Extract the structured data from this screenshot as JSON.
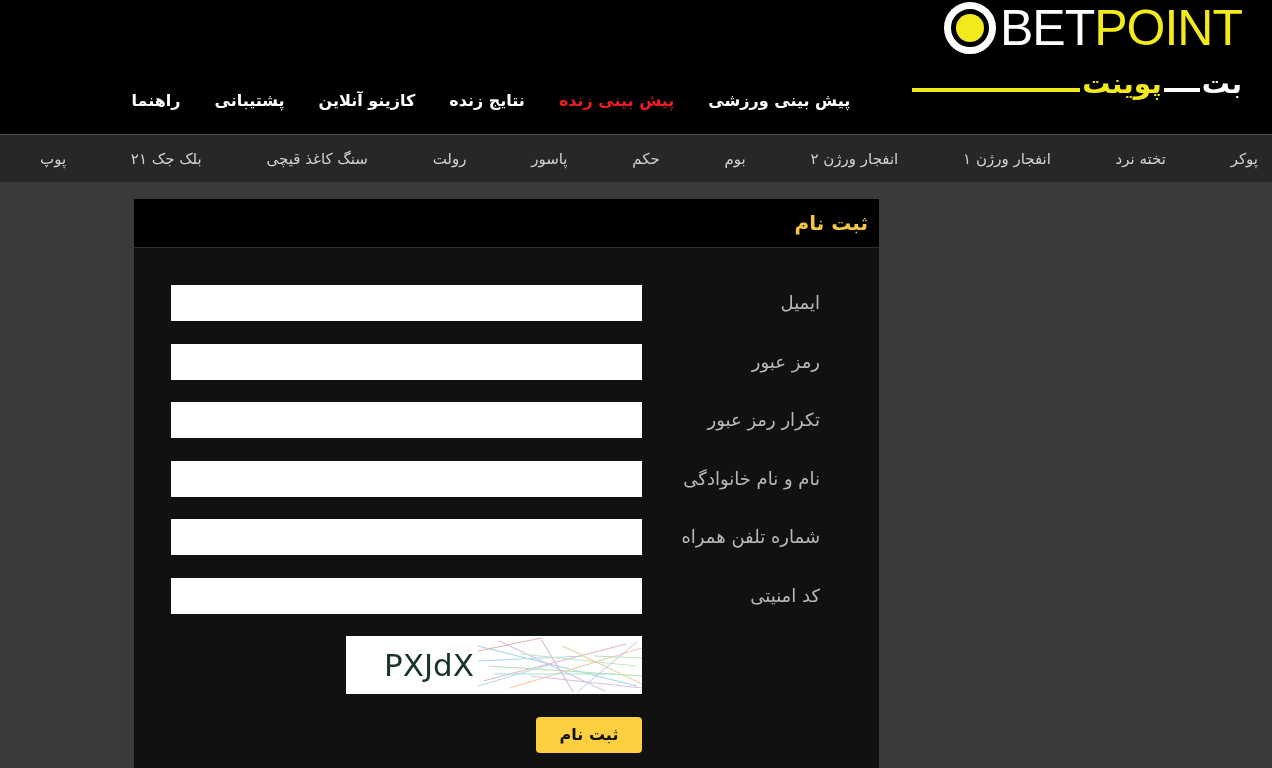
{
  "logo": {
    "word_white": "BET",
    "word_yellow": "POINT",
    "persian_white": "بت",
    "persian_yellow": "پوینت"
  },
  "main_nav": [
    {
      "label": "پیش بینی ورزشی",
      "selected": false
    },
    {
      "label": "پیش بینی زنده",
      "selected": true
    },
    {
      "label": "نتایج زنده",
      "selected": false
    },
    {
      "label": "کازینو آنلاین",
      "selected": false
    },
    {
      "label": "پشتیبانی",
      "selected": false
    },
    {
      "label": "راهنما",
      "selected": false
    }
  ],
  "games_nav": [
    "پوکر",
    "تخته نرد",
    "انفجار ورژن ۱",
    "انفجار ورژن ۲",
    "بوم",
    "حکم",
    "پاسور",
    "رولت",
    "سنگ کاغذ قیچی",
    "بلک جک ۲۱",
    "پوپ"
  ],
  "form": {
    "title": "ثبت نام",
    "fields": [
      {
        "label": "ایمیل"
      },
      {
        "label": "رمز عبور"
      },
      {
        "label": "تکرار رمز عبور"
      },
      {
        "label": "نام و نام خانوادگی"
      },
      {
        "label": "شماره تلفن همراه"
      },
      {
        "label": "کد امنیتی"
      }
    ],
    "captcha": {
      "code": "PXJdX"
    },
    "submit": "ثبت نام"
  }
}
